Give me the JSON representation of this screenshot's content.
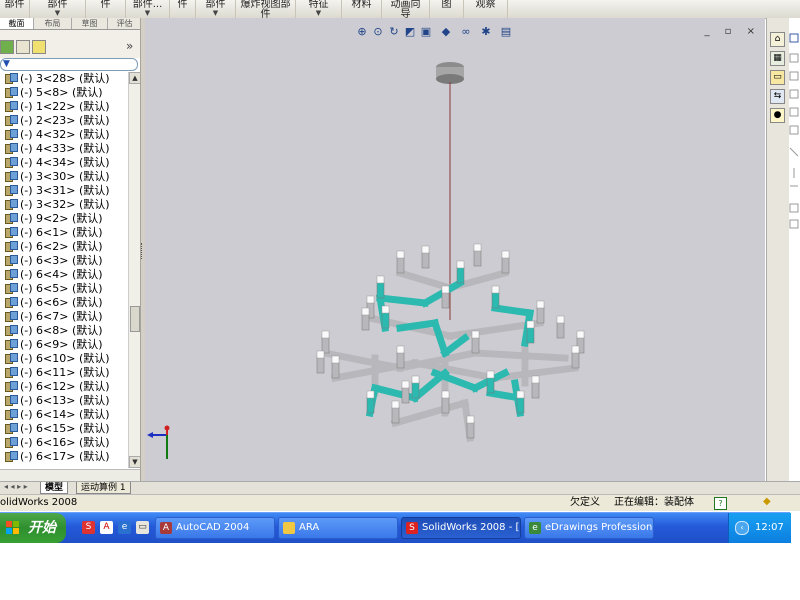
{
  "topbar": {
    "items": [
      "部件",
      "部件",
      "件",
      "部件...",
      "件",
      "部件",
      "爆炸视图部件",
      "特征",
      "材料",
      "动画向导",
      "图",
      "观察"
    ],
    "dropdown": "▼"
  },
  "left_tabs": [
    "截面",
    "布局",
    "草图",
    "评估"
  ],
  "feature_tree": {
    "collapse_label": "»",
    "items": [
      "(-) 3<28> (默认)",
      "(-) 5<8> (默认)",
      "(-) 1<22> (默认)",
      "(-) 2<23> (默认)",
      "(-) 4<32> (默认)",
      "(-) 4<33> (默认)",
      "(-) 4<34> (默认)",
      "(-) 3<30> (默认)",
      "(-) 3<31> (默认)",
      "(-) 3<32> (默认)",
      "(-) 9<2> (默认)",
      "(-) 6<1> (默认)",
      "(-) 6<2> (默认)",
      "(-) 6<3> (默认)",
      "(-) 6<4> (默认)",
      "(-) 6<5> (默认)",
      "(-) 6<6> (默认)",
      "(-) 6<7> (默认)",
      "(-) 6<8> (默认)",
      "(-) 6<9> (默认)",
      "(-) 6<10> (默认)",
      "(-) 6<11> (默认)",
      "(-) 6<12> (默认)",
      "(-) 6<13> (默认)",
      "(-) 6<14> (默认)",
      "(-) 6<15> (默认)",
      "(-) 6<16> (默认)",
      "(-) 6<17> (默认)"
    ]
  },
  "bottom_tabs": {
    "model": "模型",
    "motion": "运动算例 1"
  },
  "status": {
    "app": "olidWorks 2008",
    "definition": "欠定义",
    "editing": "正在编辑：装配体",
    "help": "?"
  },
  "window_controls": "_ ▫ ×",
  "taskbar": {
    "start": "开始",
    "tasks": [
      "AutoCAD 2004",
      "ARA",
      "SolidWorks 2008 - [...",
      "eDrawings Professional"
    ],
    "clock": "12:07"
  },
  "colors": {
    "viewport": "#ccccd2",
    "taskbar": "#2459d8",
    "start": "#2f8f2f",
    "teal_arm": "#2cb9b0",
    "grey_arm": "#b8b8bc"
  },
  "icons": [
    "zoom-fit-icon",
    "zoom-area-icon",
    "rotate-icon",
    "section-view-icon",
    "view-orientation-icon",
    "display-style-icon",
    "hide-show-icon",
    "lights-icon",
    "scene-icon",
    "triad-icon",
    "home-icon",
    "library-icon",
    "folder-icon",
    "view-palette-icon",
    "appearance-icon",
    "help-icon"
  ]
}
